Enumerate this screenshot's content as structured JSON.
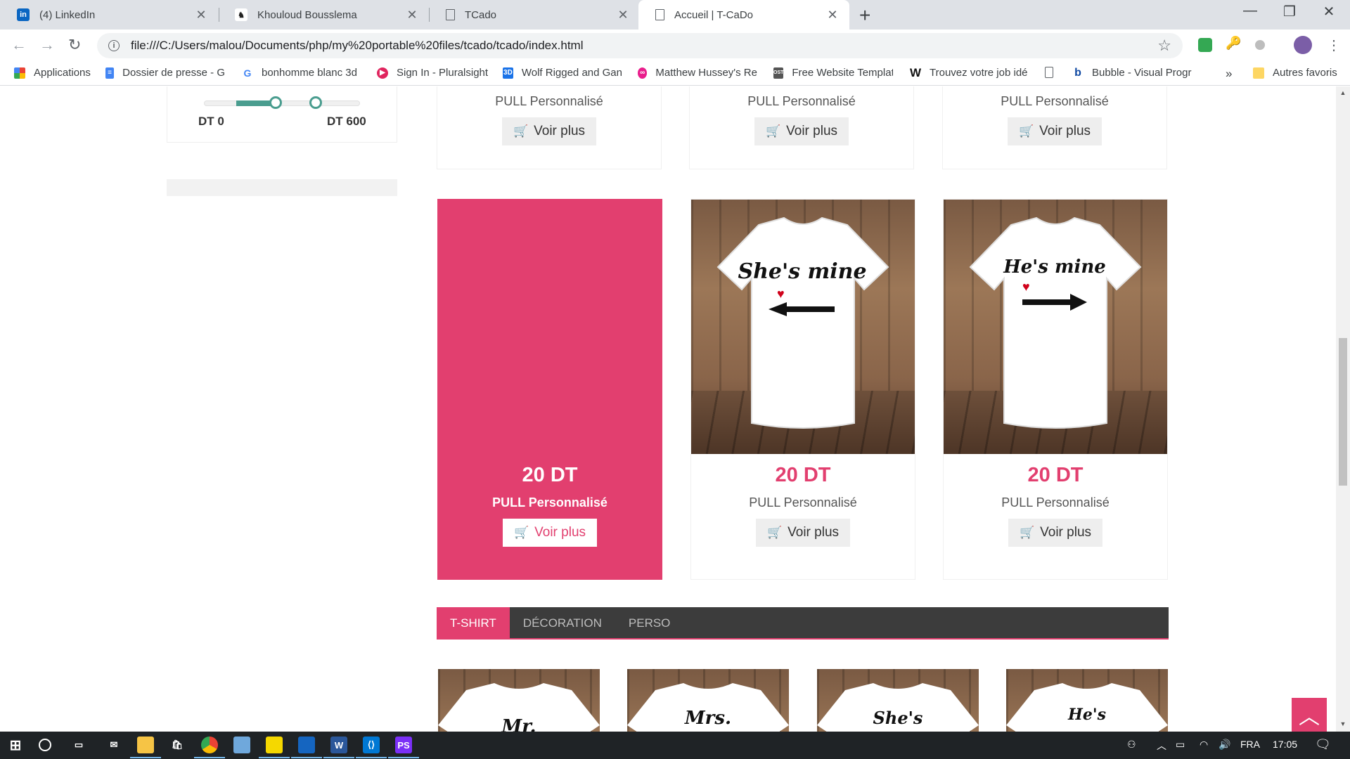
{
  "browser": {
    "tabs": [
      {
        "title": "(4) LinkedIn",
        "icon": "linkedin-icon",
        "color": "#0a66c2"
      },
      {
        "title": "Khouloud Bousslema",
        "icon": "profile-avatar-icon",
        "color": "#444444"
      },
      {
        "title": "TCado",
        "icon": "document-icon",
        "color": "#5f6368"
      },
      {
        "title": "Accueil | T-CaDo",
        "icon": "document-icon",
        "color": "#5f6368"
      }
    ],
    "url": "file:///C:/Users/malou/Documents/php/my%20portable%20files/tcado/tcado/index.html",
    "bookmarks": [
      {
        "label": "Applications",
        "icon": "apps-grid-icon"
      },
      {
        "label": "Dossier de presse - G",
        "icon": "google-docs-icon"
      },
      {
        "label": "bonhomme blanc 3d",
        "icon": "google-icon"
      },
      {
        "label": "Sign In - Pluralsight",
        "icon": "pluralsight-icon"
      },
      {
        "label": "Wolf Rigged and Gan",
        "icon": "3d-icon"
      },
      {
        "label": "Matthew Hussey's Re",
        "icon": "infinity-icon"
      },
      {
        "label": "Free Website Templat",
        "icon": "ost-icon"
      },
      {
        "label": "Trouvez votre job idé",
        "icon": "w-logo-icon"
      },
      {
        "label": "",
        "icon": "blank-page-icon"
      },
      {
        "label": "Bubble - Visual Progr",
        "icon": "bubble-icon"
      }
    ],
    "more_bookmarks": "»",
    "other_favorites": "Autres favoris"
  },
  "sidebar": {
    "price_min": "DT 0",
    "price_max": "DT 600"
  },
  "products_top_row": [
    {
      "name": "PULL Personnalisé",
      "button": "Voir plus"
    },
    {
      "name": "PULL Personnalisé",
      "button": "Voir plus"
    },
    {
      "name": "PULL Personnalisé",
      "button": "Voir plus"
    }
  ],
  "products_row": [
    {
      "price": "20 DT",
      "name": "PULL Personnalisé",
      "button": "Voir plus",
      "highlighted": true
    },
    {
      "price": "20 DT",
      "name": "PULL Personnalisé",
      "button": "Voir plus",
      "print": "She's mine",
      "arrow": "left"
    },
    {
      "price": "20 DT",
      "name": "PULL Personnalisé",
      "button": "Voir plus",
      "print": "He's mine",
      "arrow": "right"
    }
  ],
  "categories": [
    "T-SHIRT",
    "DÉCORATION",
    "PERSO"
  ],
  "bottom_shirt_prints": [
    "Mr.",
    "Mrs.",
    "She's",
    "He's"
  ],
  "colors": {
    "accent": "#e23f6f",
    "slider": "#4a9d8f",
    "dark_bar": "#3c3c3c"
  },
  "taskbar": {
    "language": "FRA",
    "time": "17:05"
  }
}
